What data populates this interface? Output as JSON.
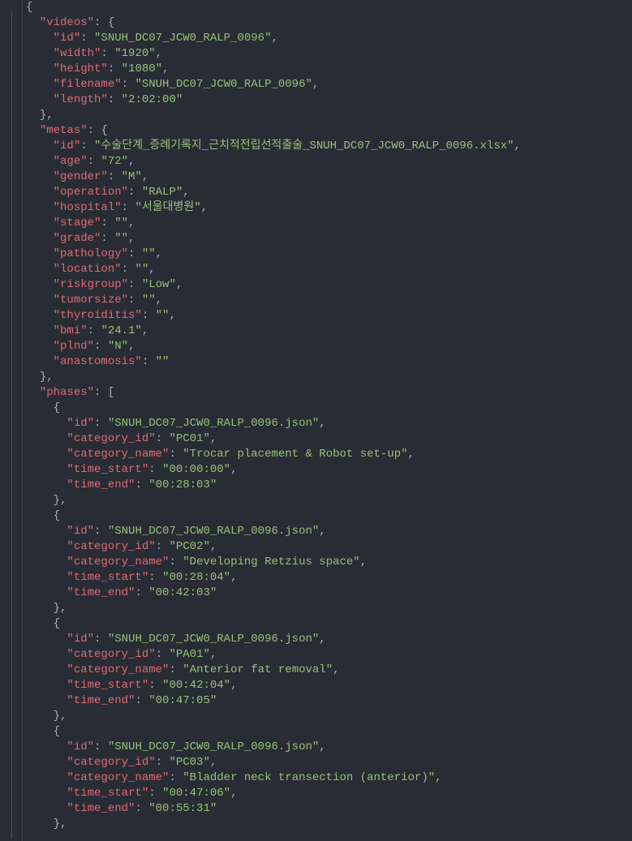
{
  "tokens": [
    [
      [
        "p",
        "{"
      ]
    ],
    [
      [
        "p",
        "  "
      ],
      [
        "k",
        "\"videos\""
      ],
      [
        "p",
        ": "
      ],
      [
        "p",
        "{"
      ]
    ],
    [
      [
        "p",
        "    "
      ],
      [
        "k",
        "\"id\""
      ],
      [
        "p",
        ": "
      ],
      [
        "s",
        "\"SNUH_DC07_JCW0_RALP_0096\""
      ],
      [
        "p",
        ","
      ]
    ],
    [
      [
        "p",
        "    "
      ],
      [
        "k",
        "\"width\""
      ],
      [
        "p",
        ": "
      ],
      [
        "s",
        "\"1920\""
      ],
      [
        "p",
        ","
      ]
    ],
    [
      [
        "p",
        "    "
      ],
      [
        "k",
        "\"height\""
      ],
      [
        "p",
        ": "
      ],
      [
        "s",
        "\"1080\""
      ],
      [
        "p",
        ","
      ]
    ],
    [
      [
        "p",
        "    "
      ],
      [
        "k",
        "\"filename\""
      ],
      [
        "p",
        ": "
      ],
      [
        "s",
        "\"SNUH_DC07_JCW0_RALP_0096\""
      ],
      [
        "p",
        ","
      ]
    ],
    [
      [
        "p",
        "    "
      ],
      [
        "k",
        "\"length\""
      ],
      [
        "p",
        ": "
      ],
      [
        "s",
        "\"2:02:00\""
      ]
    ],
    [
      [
        "p",
        "  "
      ],
      [
        "p",
        "},"
      ]
    ],
    [
      [
        "p",
        "  "
      ],
      [
        "k",
        "\"metas\""
      ],
      [
        "p",
        ": "
      ],
      [
        "p",
        "{"
      ]
    ],
    [
      [
        "p",
        "    "
      ],
      [
        "k",
        "\"id\""
      ],
      [
        "p",
        ": "
      ],
      [
        "s",
        "\"수술단계_증례기록지_근치적전립선적출술_SNUH_DC07_JCW0_RALP_0096.xlsx\""
      ],
      [
        "p",
        ","
      ]
    ],
    [
      [
        "p",
        "    "
      ],
      [
        "k",
        "\"age\""
      ],
      [
        "p",
        ": "
      ],
      [
        "s",
        "\"72\""
      ],
      [
        "p",
        ","
      ]
    ],
    [
      [
        "p",
        "    "
      ],
      [
        "k",
        "\"gender\""
      ],
      [
        "p",
        ": "
      ],
      [
        "s",
        "\"M\""
      ],
      [
        "p",
        ","
      ]
    ],
    [
      [
        "p",
        "    "
      ],
      [
        "k",
        "\"operation\""
      ],
      [
        "p",
        ": "
      ],
      [
        "s",
        "\"RALP\""
      ],
      [
        "p",
        ","
      ]
    ],
    [
      [
        "p",
        "    "
      ],
      [
        "k",
        "\"hospital\""
      ],
      [
        "p",
        ": "
      ],
      [
        "s",
        "\"서울대병원\""
      ],
      [
        "p",
        ","
      ]
    ],
    [
      [
        "p",
        "    "
      ],
      [
        "k",
        "\"stage\""
      ],
      [
        "p",
        ": "
      ],
      [
        "s",
        "\"\""
      ],
      [
        "p",
        ","
      ]
    ],
    [
      [
        "p",
        "    "
      ],
      [
        "k",
        "\"grade\""
      ],
      [
        "p",
        ": "
      ],
      [
        "s",
        "\"\""
      ],
      [
        "p",
        ","
      ]
    ],
    [
      [
        "p",
        "    "
      ],
      [
        "k",
        "\"pathology\""
      ],
      [
        "p",
        ": "
      ],
      [
        "s",
        "\"\""
      ],
      [
        "p",
        ","
      ]
    ],
    [
      [
        "p",
        "    "
      ],
      [
        "k",
        "\"location\""
      ],
      [
        "p",
        ": "
      ],
      [
        "s",
        "\"\""
      ],
      [
        "p",
        ","
      ]
    ],
    [
      [
        "p",
        "    "
      ],
      [
        "k",
        "\"riskgroup\""
      ],
      [
        "p",
        ": "
      ],
      [
        "s",
        "\"Low\""
      ],
      [
        "p",
        ","
      ]
    ],
    [
      [
        "p",
        "    "
      ],
      [
        "k",
        "\"tumorsize\""
      ],
      [
        "p",
        ": "
      ],
      [
        "s",
        "\"\""
      ],
      [
        "p",
        ","
      ]
    ],
    [
      [
        "p",
        "    "
      ],
      [
        "k",
        "\"thyroiditis\""
      ],
      [
        "p",
        ": "
      ],
      [
        "s",
        "\"\""
      ],
      [
        "p",
        ","
      ]
    ],
    [
      [
        "p",
        "    "
      ],
      [
        "k",
        "\"bmi\""
      ],
      [
        "p",
        ": "
      ],
      [
        "s",
        "\"24.1\""
      ],
      [
        "p",
        ","
      ]
    ],
    [
      [
        "p",
        "    "
      ],
      [
        "k",
        "\"plnd\""
      ],
      [
        "p",
        ": "
      ],
      [
        "s",
        "\"N\""
      ],
      [
        "p",
        ","
      ]
    ],
    [
      [
        "p",
        "    "
      ],
      [
        "k",
        "\"anastomosis\""
      ],
      [
        "p",
        ": "
      ],
      [
        "s",
        "\"\""
      ]
    ],
    [
      [
        "p",
        "  "
      ],
      [
        "p",
        "},"
      ]
    ],
    [
      [
        "p",
        "  "
      ],
      [
        "k",
        "\"phases\""
      ],
      [
        "p",
        ": "
      ],
      [
        "p",
        "["
      ]
    ],
    [
      [
        "p",
        "    "
      ],
      [
        "p",
        "{"
      ]
    ],
    [
      [
        "p",
        "      "
      ],
      [
        "k",
        "\"id\""
      ],
      [
        "p",
        ": "
      ],
      [
        "s",
        "\"SNUH_DC07_JCW0_RALP_0096.json\""
      ],
      [
        "p",
        ","
      ]
    ],
    [
      [
        "p",
        "      "
      ],
      [
        "k",
        "\"category_id\""
      ],
      [
        "p",
        ": "
      ],
      [
        "s",
        "\"PC01\""
      ],
      [
        "p",
        ","
      ]
    ],
    [
      [
        "p",
        "      "
      ],
      [
        "k",
        "\"category_name\""
      ],
      [
        "p",
        ": "
      ],
      [
        "s",
        "\"Trocar placement & Robot set-up\""
      ],
      [
        "p",
        ","
      ]
    ],
    [
      [
        "p",
        "      "
      ],
      [
        "k",
        "\"time_start\""
      ],
      [
        "p",
        ": "
      ],
      [
        "s",
        "\"00:00:00\""
      ],
      [
        "p",
        ","
      ]
    ],
    [
      [
        "p",
        "      "
      ],
      [
        "k",
        "\"time_end\""
      ],
      [
        "p",
        ": "
      ],
      [
        "s",
        "\"00:28:03\""
      ]
    ],
    [
      [
        "p",
        "    "
      ],
      [
        "p",
        "},"
      ]
    ],
    [
      [
        "p",
        "    "
      ],
      [
        "p",
        "{"
      ]
    ],
    [
      [
        "p",
        "      "
      ],
      [
        "k",
        "\"id\""
      ],
      [
        "p",
        ": "
      ],
      [
        "s",
        "\"SNUH_DC07_JCW0_RALP_0096.json\""
      ],
      [
        "p",
        ","
      ]
    ],
    [
      [
        "p",
        "      "
      ],
      [
        "k",
        "\"category_id\""
      ],
      [
        "p",
        ": "
      ],
      [
        "s",
        "\"PC02\""
      ],
      [
        "p",
        ","
      ]
    ],
    [
      [
        "p",
        "      "
      ],
      [
        "k",
        "\"category_name\""
      ],
      [
        "p",
        ": "
      ],
      [
        "s",
        "\"Developing Retzius space\""
      ],
      [
        "p",
        ","
      ]
    ],
    [
      [
        "p",
        "      "
      ],
      [
        "k",
        "\"time_start\""
      ],
      [
        "p",
        ": "
      ],
      [
        "s",
        "\"00:28:04\""
      ],
      [
        "p",
        ","
      ]
    ],
    [
      [
        "p",
        "      "
      ],
      [
        "k",
        "\"time_end\""
      ],
      [
        "p",
        ": "
      ],
      [
        "s",
        "\"00:42:03\""
      ]
    ],
    [
      [
        "p",
        "    "
      ],
      [
        "p",
        "},"
      ]
    ],
    [
      [
        "p",
        "    "
      ],
      [
        "p",
        "{"
      ]
    ],
    [
      [
        "p",
        "      "
      ],
      [
        "k",
        "\"id\""
      ],
      [
        "p",
        ": "
      ],
      [
        "s",
        "\"SNUH_DC07_JCW0_RALP_0096.json\""
      ],
      [
        "p",
        ","
      ]
    ],
    [
      [
        "p",
        "      "
      ],
      [
        "k",
        "\"category_id\""
      ],
      [
        "p",
        ": "
      ],
      [
        "s",
        "\"PA01\""
      ],
      [
        "p",
        ","
      ]
    ],
    [
      [
        "p",
        "      "
      ],
      [
        "k",
        "\"category_name\""
      ],
      [
        "p",
        ": "
      ],
      [
        "s",
        "\"Anterior fat removal\""
      ],
      [
        "p",
        ","
      ]
    ],
    [
      [
        "p",
        "      "
      ],
      [
        "k",
        "\"time_start\""
      ],
      [
        "p",
        ": "
      ],
      [
        "s",
        "\"00:42:04\""
      ],
      [
        "p",
        ","
      ]
    ],
    [
      [
        "p",
        "      "
      ],
      [
        "k",
        "\"time_end\""
      ],
      [
        "p",
        ": "
      ],
      [
        "s",
        "\"00:47:05\""
      ]
    ],
    [
      [
        "p",
        "    "
      ],
      [
        "p",
        "},"
      ]
    ],
    [
      [
        "p",
        "    "
      ],
      [
        "p",
        "{"
      ]
    ],
    [
      [
        "p",
        "      "
      ],
      [
        "k",
        "\"id\""
      ],
      [
        "p",
        ": "
      ],
      [
        "s",
        "\"SNUH_DC07_JCW0_RALP_0096.json\""
      ],
      [
        "p",
        ","
      ]
    ],
    [
      [
        "p",
        "      "
      ],
      [
        "k",
        "\"category_id\""
      ],
      [
        "p",
        ": "
      ],
      [
        "s",
        "\"PC03\""
      ],
      [
        "p",
        ","
      ]
    ],
    [
      [
        "p",
        "      "
      ],
      [
        "k",
        "\"category_name\""
      ],
      [
        "p",
        ": "
      ],
      [
        "s",
        "\"Bladder neck transection (anterior)\""
      ],
      [
        "p",
        ","
      ]
    ],
    [
      [
        "p",
        "      "
      ],
      [
        "k",
        "\"time_start\""
      ],
      [
        "p",
        ": "
      ],
      [
        "s",
        "\"00:47:06\""
      ],
      [
        "p",
        ","
      ]
    ],
    [
      [
        "p",
        "      "
      ],
      [
        "k",
        "\"time_end\""
      ],
      [
        "p",
        ": "
      ],
      [
        "s",
        "\"00:55:31\""
      ]
    ],
    [
      [
        "p",
        "    "
      ],
      [
        "p",
        "},"
      ]
    ]
  ]
}
